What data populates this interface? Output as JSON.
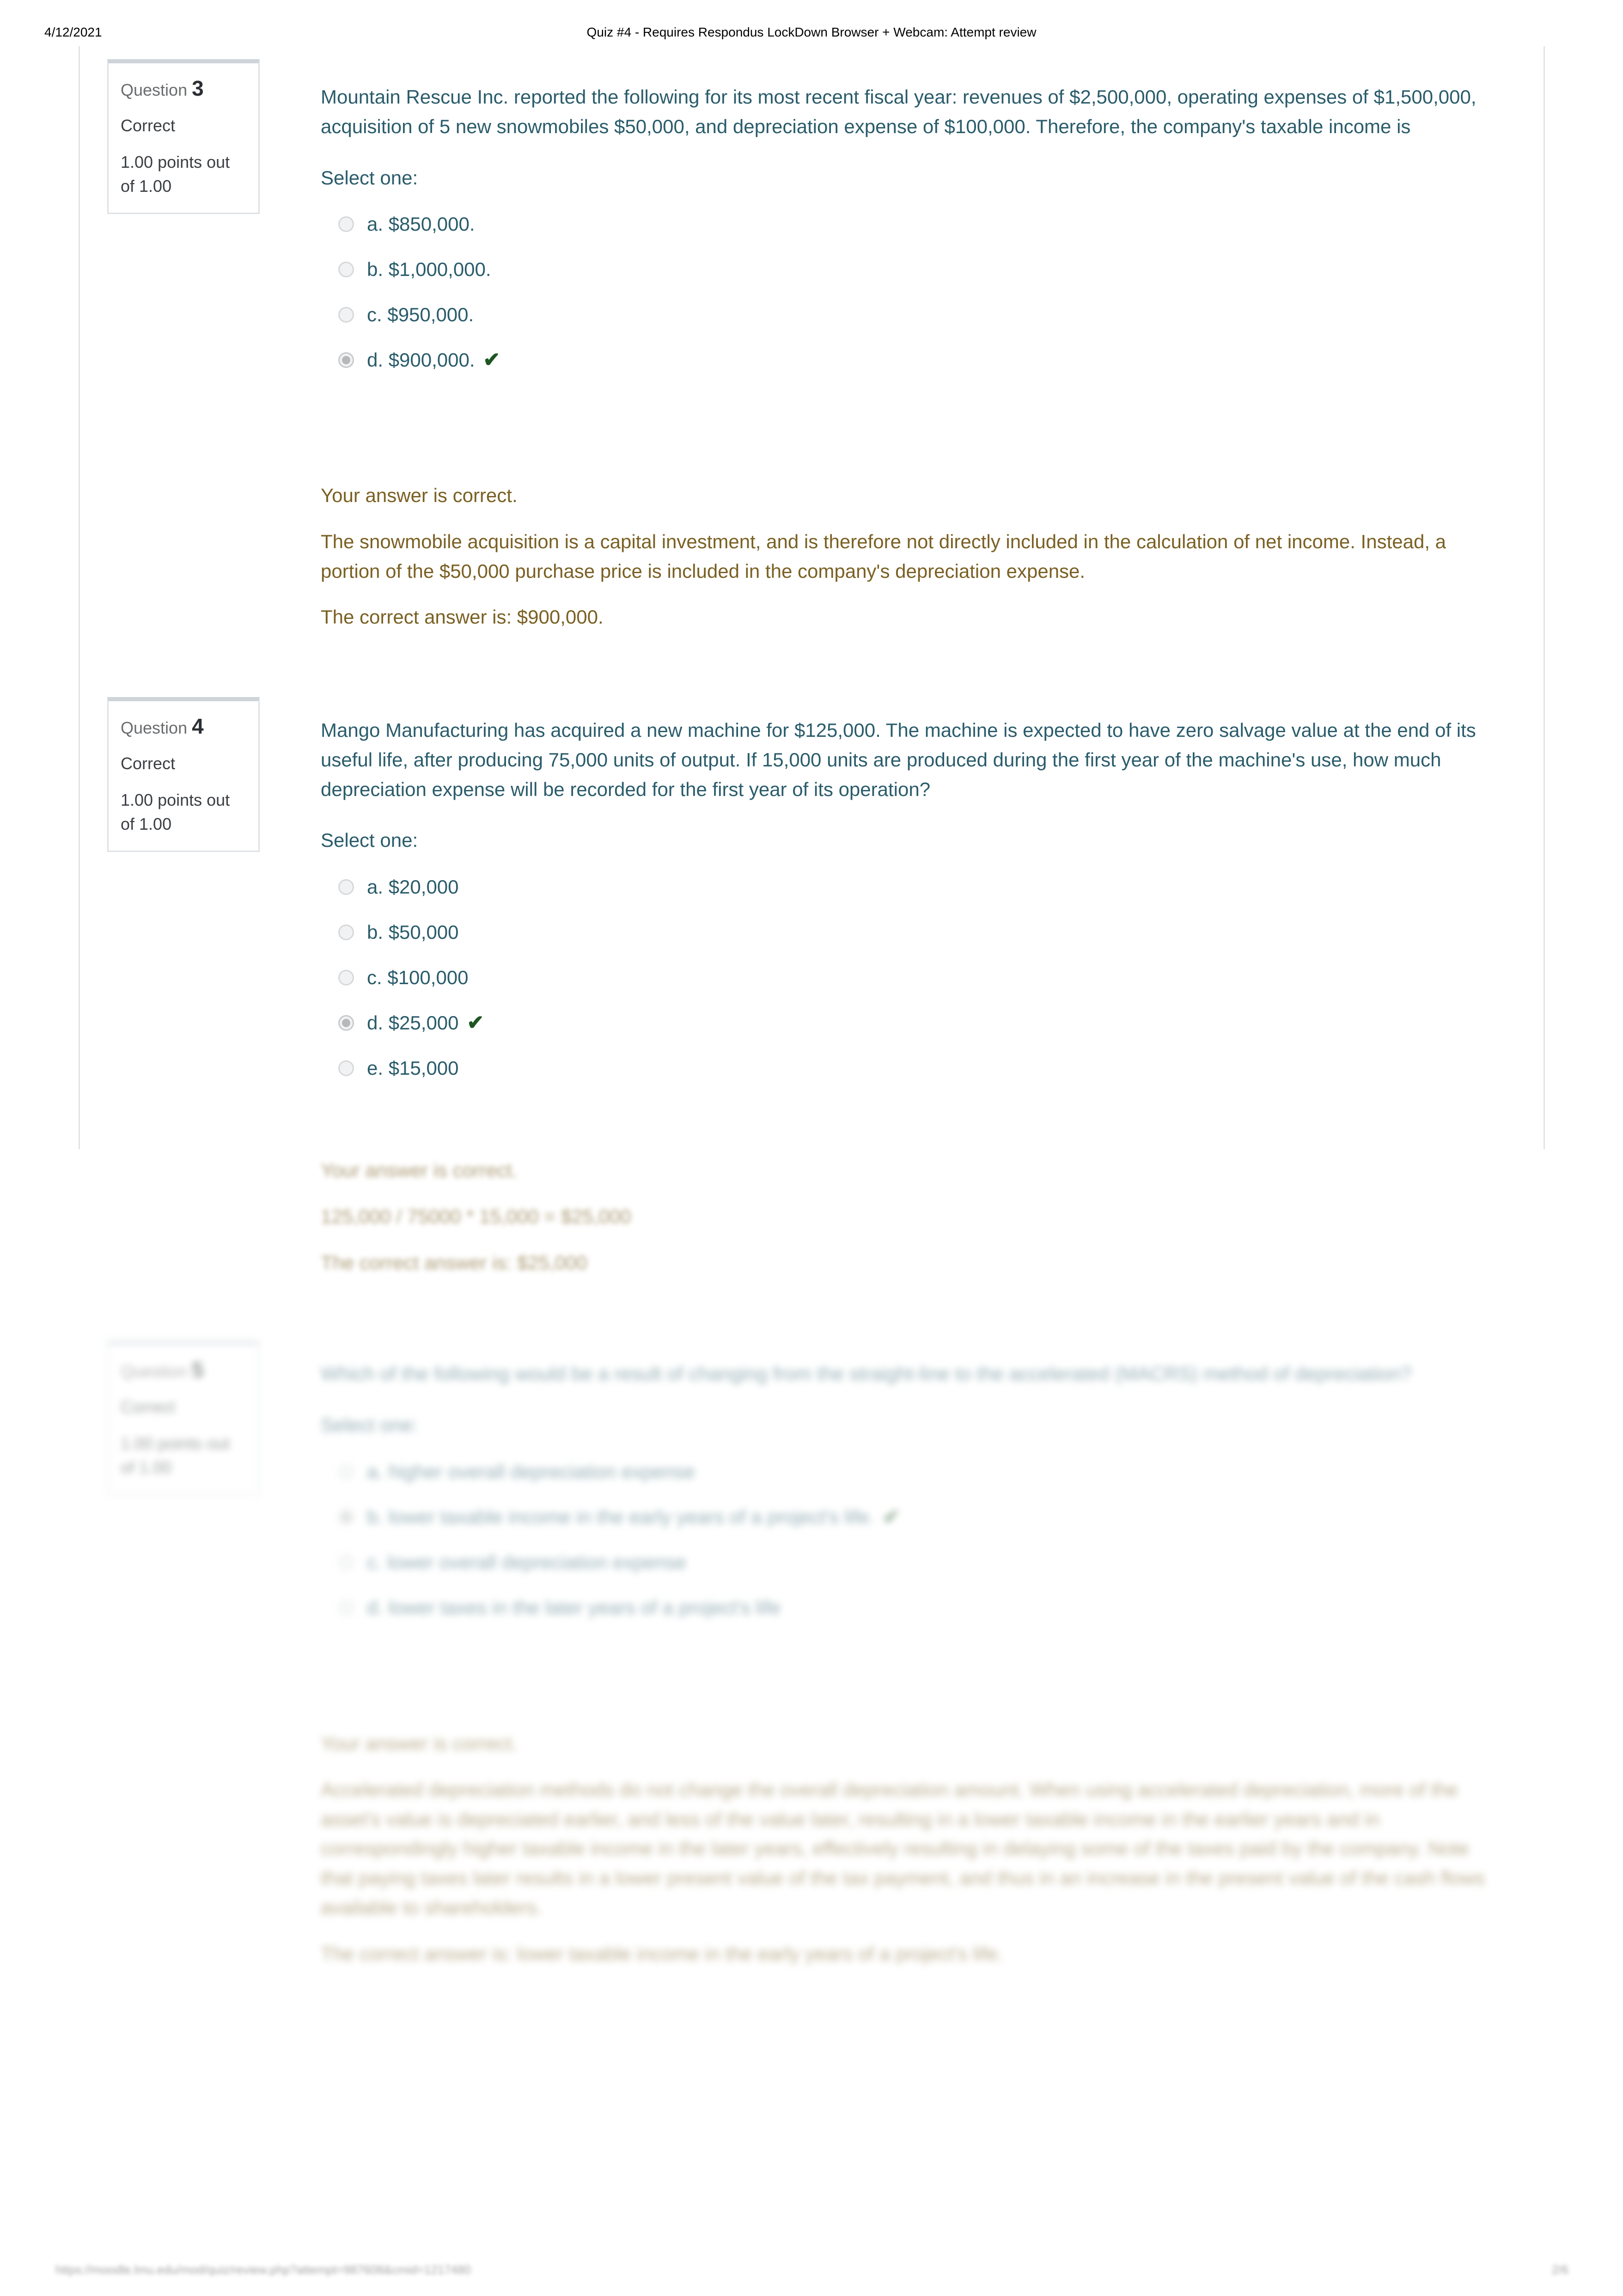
{
  "print_header": {
    "date": "4/12/2021",
    "title": "Quiz #4 - Requires Respondus LockDown Browser + Webcam: Attempt review"
  },
  "print_footer": {
    "url": "https://moodle.lmu.edu/mod/quiz/review.php?attempt=987608&cmid=1217480",
    "page": "2/6"
  },
  "questions": [
    {
      "number_label": "Question",
      "number": "3",
      "state": "Correct",
      "grade": "1.00 points out of 1.00",
      "text": "Mountain Rescue Inc. reported the following for its most recent fiscal year: revenues of $2,500,000, operating expenses of $1,500,000, acquisition of 5 new snowmobiles $50,000, and depreciation expense of $100,000. Therefore, the company's taxable income is",
      "prompt": "Select one:",
      "options": [
        {
          "label": "a. $850,000.",
          "selected": false,
          "correct": false
        },
        {
          "label": "b. $1,000,000.",
          "selected": false,
          "correct": false
        },
        {
          "label": "c. $950,000.",
          "selected": false,
          "correct": false
        },
        {
          "label": "d. $900,000.",
          "selected": true,
          "correct": true
        }
      ],
      "tick_glyph": "✔",
      "feedback": [
        "Your answer is correct.",
        "The snowmobile acquisition is a capital investment, and is therefore not directly included in the calculation of net income. Instead, a portion of the $50,000 purchase price is included in the company's depreciation expense.",
        "The correct answer is: $900,000."
      ]
    },
    {
      "number_label": "Question",
      "number": "4",
      "state": "Correct",
      "grade": "1.00 points out of 1.00",
      "text": "Mango Manufacturing has acquired a new machine for $125,000. The machine is expected to have zero salvage value at the end of its useful life, after producing 75,000 units of output. If 15,000 units are produced during the first year of the machine's use, how much depreciation expense will be recorded for the first year of its operation?",
      "prompt": "Select one:",
      "options": [
        {
          "label": "a. $20,000",
          "selected": false,
          "correct": false
        },
        {
          "label": "b. $50,000",
          "selected": false,
          "correct": false
        },
        {
          "label": "c. $100,000",
          "selected": false,
          "correct": false
        },
        {
          "label": "d. $25,000",
          "selected": true,
          "correct": true
        },
        {
          "label": "e. $15,000",
          "selected": false,
          "correct": false
        }
      ],
      "tick_glyph": "✔",
      "feedback": [
        "Your answer is correct.",
        "125,000 / 75000 * 15,000 = $25,000",
        "The correct answer is: $25,000"
      ]
    },
    {
      "number_label": "Question",
      "number": "5",
      "state": "Correct",
      "grade": "1.00 points out of 1.00",
      "text": "Which of the following would be a result of changing from the straight-line to the accelerated (MACRS) method of depreciation?",
      "prompt": "Select one:",
      "options": [
        {
          "label": "a. higher overall depreciation expense",
          "selected": false,
          "correct": false
        },
        {
          "label": "b. lower taxable income in the early years of a project's life.",
          "selected": true,
          "correct": true
        },
        {
          "label": "c. lower overall depreciation expense",
          "selected": false,
          "correct": false
        },
        {
          "label": "d. lower taxes in the later years of a project's life",
          "selected": false,
          "correct": false
        }
      ],
      "tick_glyph": "✔",
      "feedback": [
        "Your answer is correct.",
        "Accelerated depreciation methods do not change the overall depreciation amount. When using accelerated depreciation, more of the asset's value is depreciated earlier, and less of the value later, resulting in a lower taxable income in the earlier years and in correspondingly higher taxable income in the later years, effectively resulting in delaying some of the taxes paid by the company. Note that paying taxes later results in a lower present value of the tax payment, and thus in an increase in the present value of the cash flows available to shareholders.",
        "The correct answer is: lower taxable income in the early years of a project's life."
      ]
    }
  ]
}
